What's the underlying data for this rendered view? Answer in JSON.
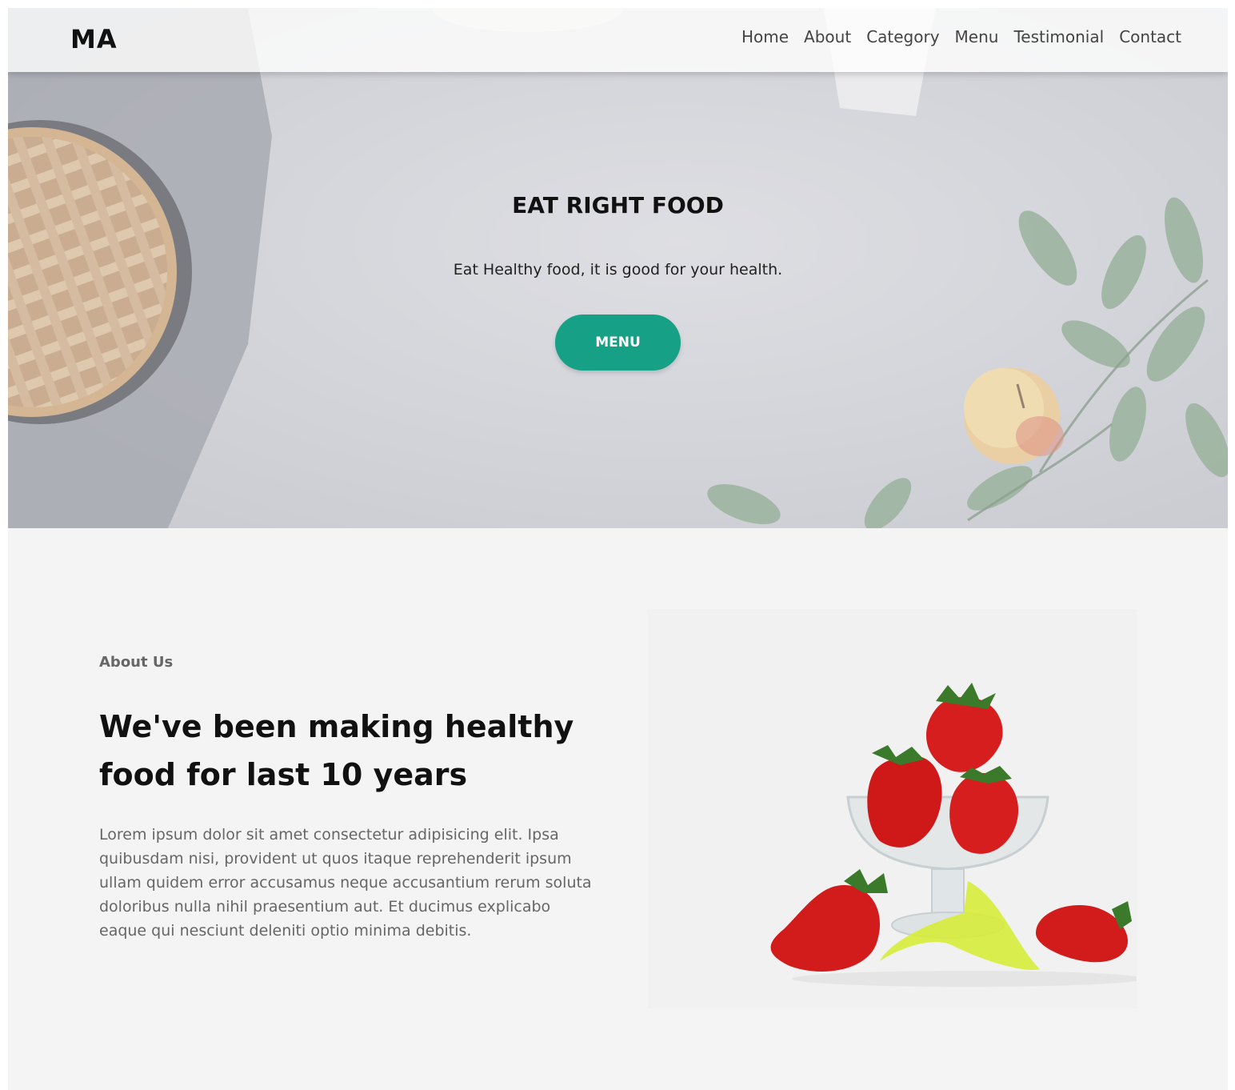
{
  "brand": {
    "logo": "MA"
  },
  "nav": {
    "items": [
      {
        "label": "Home"
      },
      {
        "label": "About"
      },
      {
        "label": "Category"
      },
      {
        "label": "Menu"
      },
      {
        "label": "Testimonial"
      },
      {
        "label": "Contact"
      }
    ]
  },
  "hero": {
    "title": "EAT RIGHT FOOD",
    "subtitle": "Eat Healthy food, it is good for your health.",
    "button_label": "MENU"
  },
  "about": {
    "eyebrow": "About Us",
    "heading": "We've been making healthy food for last 10 years",
    "text": "Lorem ipsum dolor sit amet consectetur adipisicing elit. Ipsa quibusdam nisi, provident ut quos itaque reprehenderit ipsum ullam quidem error accusamus neque accusantium rerum soluta doloribus nulla nihil praesentium aut. Et ducimus explicabo eaque qui nesciunt deleniti optio minima debitis."
  },
  "colors": {
    "accent": "#16a085",
    "page_bg": "#f4f4f4",
    "text_dark": "#111111",
    "text_muted": "#666666"
  },
  "icons": {
    "hero_image": "pie-apple-leaves-photo",
    "about_image": "strawberries-glass-bowl-photo"
  }
}
